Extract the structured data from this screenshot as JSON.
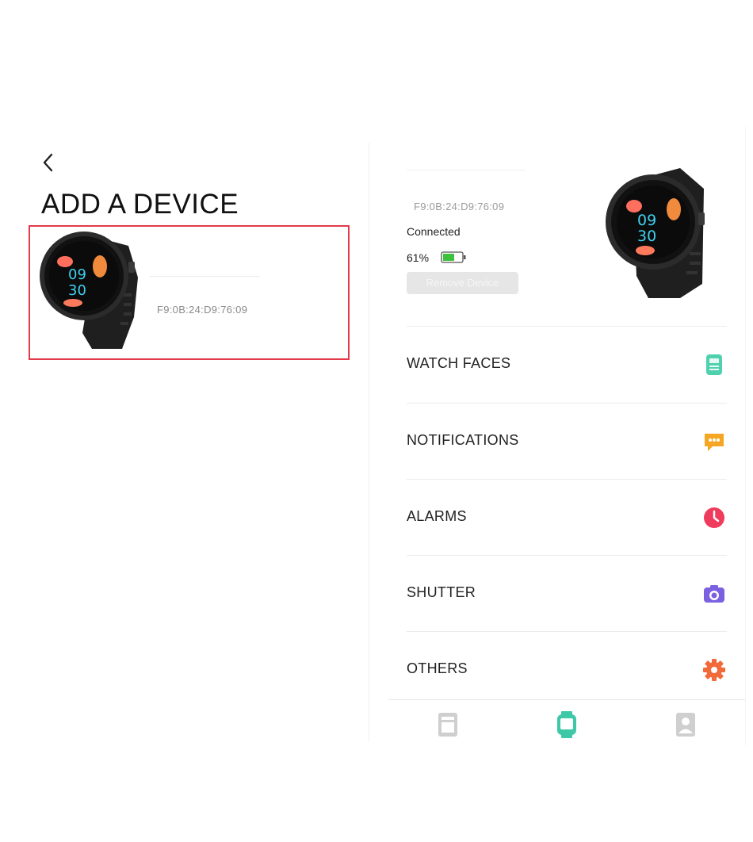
{
  "add_device": {
    "title": "ADD A DEVICE",
    "device_mac": "F9:0B:24:D9:76:09"
  },
  "device_detail": {
    "mac": "F9:0B:24:D9:76:09",
    "status": "Connected",
    "battery": "61%",
    "battery_level": 0.61,
    "remove_label": "Remove Device"
  },
  "menu": [
    {
      "label": "WATCH FACES",
      "icon": "watch-face-icon",
      "color": "#4fd1b0"
    },
    {
      "label": "NOTIFICATIONS",
      "icon": "message-icon",
      "color": "#f5a623"
    },
    {
      "label": "ALARMS",
      "icon": "clock-icon",
      "color": "#ef3b5c"
    },
    {
      "label": "SHUTTER",
      "icon": "camera-icon",
      "color": "#7b61e0"
    },
    {
      "label": "OTHERS",
      "icon": "gear-icon",
      "color": "#f26a3a"
    }
  ],
  "tabbar": [
    {
      "icon": "dashboard-icon",
      "active": false
    },
    {
      "icon": "device-icon",
      "active": true
    },
    {
      "icon": "profile-icon",
      "active": false
    }
  ],
  "colors": {
    "accent": "#3fc8a8",
    "highlight_border": "#e23a4a",
    "inactive_tab": "#cfcfcf"
  }
}
